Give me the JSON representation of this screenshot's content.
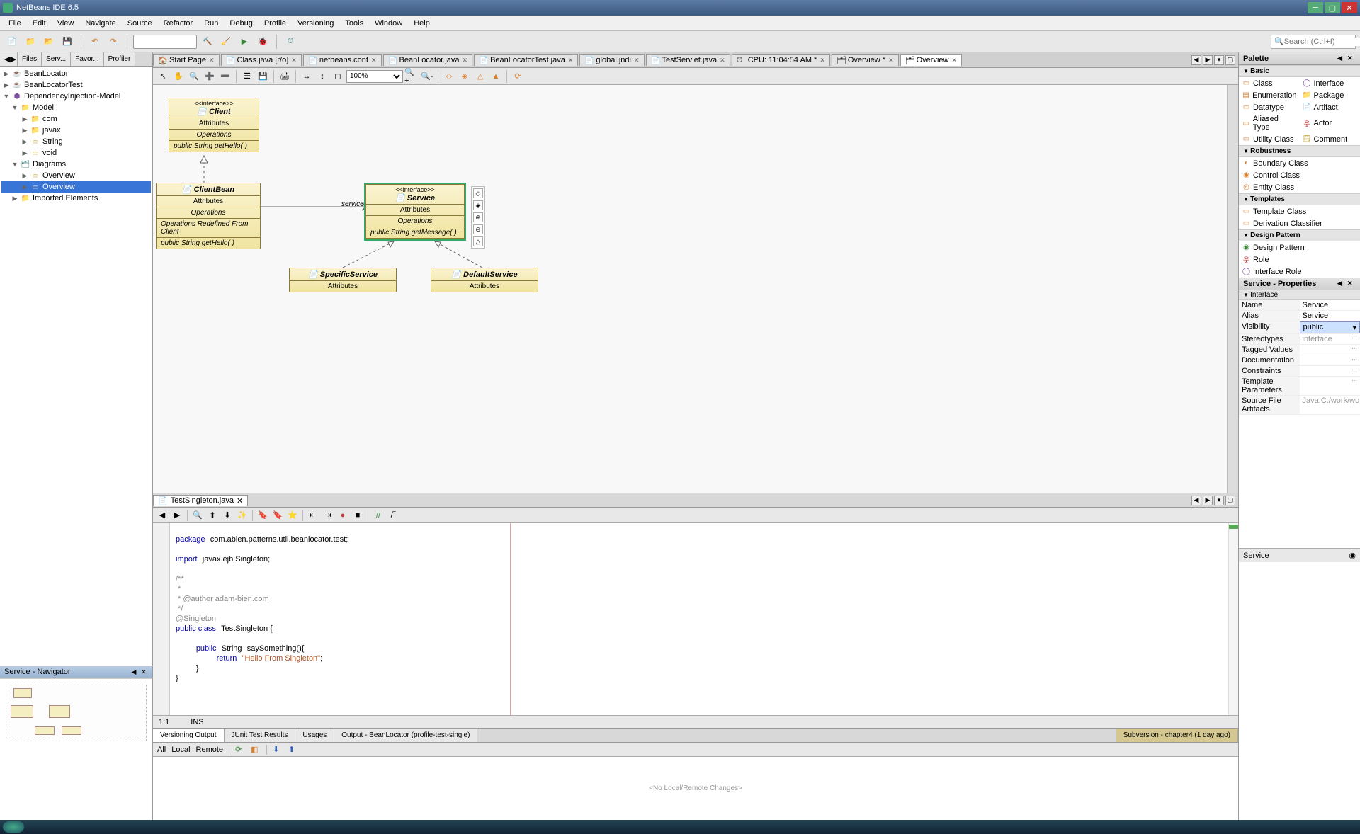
{
  "title": "NetBeans IDE 6.5",
  "menu": [
    "File",
    "Edit",
    "View",
    "Navigate",
    "Source",
    "Refactor",
    "Run",
    "Debug",
    "Profile",
    "Versioning",
    "Tools",
    "Window",
    "Help"
  ],
  "search_placeholder": "Search (Ctrl+I)",
  "left_tabs": [
    "Files",
    "Serv...",
    "Favor...",
    "Profiler"
  ],
  "tree": {
    "n0": "BeanLocator",
    "n1": "BeanLocatorTest",
    "n2": "DependencyInjection-Model",
    "n3": "Model",
    "n4": "com",
    "n5": "javax",
    "n6": "String",
    "n7": "void",
    "n8": "Diagrams",
    "n9": "Overview",
    "n10": "Overview",
    "n11": "Imported Elements"
  },
  "navigator_title": "Service - Navigator",
  "editor_tabs": [
    {
      "label": "Start Page",
      "icon": "🏠"
    },
    {
      "label": "Class.java [r/o]",
      "icon": "📄"
    },
    {
      "label": "netbeans.conf",
      "icon": "📄"
    },
    {
      "label": "BeanLocator.java",
      "icon": "📄"
    },
    {
      "label": "BeanLocatorTest.java",
      "icon": "📄"
    },
    {
      "label": "global.jndi",
      "icon": "📄"
    },
    {
      "label": "TestServlet.java",
      "icon": "📄"
    },
    {
      "label": "CPU: 11:04:54 AM *",
      "icon": "⏱"
    },
    {
      "label": "Overview *",
      "icon": "🗂"
    },
    {
      "label": "Overview",
      "icon": "🗂"
    }
  ],
  "zoom": "100%",
  "uml": {
    "client": {
      "stereo": "<<interface>>",
      "name": "Client",
      "attrs": "Attributes",
      "ops_hdr": "Operations",
      "op1": "public String  getHello( )"
    },
    "clientbean": {
      "name": "ClientBean",
      "attrs": "Attributes",
      "ops_hdr": "Operations",
      "redef": "Operations Redefined From Client",
      "op1": "public String  getHello( )"
    },
    "service": {
      "stereo": "<<interface>>",
      "name": "Service",
      "attrs": "Attributes",
      "ops_hdr": "Operations",
      "op1": "public String  getMessage( )",
      "assoc": "service"
    },
    "specific": {
      "name": "SpecificService",
      "attrs": "Attributes"
    },
    "default": {
      "name": "DefaultService",
      "attrs": "Attributes"
    }
  },
  "code_tab": "TestSingleton.java",
  "code": {
    "pkg": "package",
    "pkg_path": "com.abien.patterns.util.beanlocator.test;",
    "imp": "import",
    "imp_path": "javax.ejb.Singleton;",
    "c1": "/**",
    "c2": " *",
    "c3": " * @author adam-bien.com",
    "c4": " */",
    "ann": "@Singleton",
    "cls": "public class",
    "cls_name": "TestSingleton {",
    "meth": "public",
    "meth_type": "String",
    "meth_name": "saySomething(){",
    "ret": "return",
    "ret_val": "\"Hello From Singleton\"",
    "semi": ";",
    "brace1": "}",
    "brace2": "}"
  },
  "code_status": {
    "pos": "1:1",
    "mode": "INS"
  },
  "output_tabs": [
    "Versioning Output",
    "JUnit Test Results",
    "Usages",
    "Output - BeanLocator (profile-test-single)"
  ],
  "output_tab_ext": "Subversion - chapter4 (1 day ago)",
  "output_filter": {
    "all": "All",
    "local": "Local",
    "remote": "Remote"
  },
  "output_msg": "<No Local/Remote Changes>",
  "palette": {
    "title": "Palette",
    "cats": {
      "basic": "Basic",
      "robust": "Robustness",
      "templates": "Templates",
      "design": "Design Pattern"
    },
    "basic_items": [
      "Class",
      "Interface",
      "Enumeration",
      "Package",
      "Datatype",
      "Artifact",
      "Aliased Type",
      "Actor",
      "Utility Class",
      "Comment"
    ],
    "robust_items": [
      "Boundary Class",
      "Control Class",
      "Entity Class"
    ],
    "template_items": [
      "Template Class",
      "Derivation Classifier"
    ],
    "design_items": [
      "Design Pattern",
      "Role",
      "Interface Role"
    ]
  },
  "props": {
    "title": "Service - Properties",
    "cat": "Interface",
    "rows": [
      {
        "k": "Name",
        "v": "Service"
      },
      {
        "k": "Alias",
        "v": "Service"
      },
      {
        "k": "Visibility",
        "v": "public"
      },
      {
        "k": "Stereotypes",
        "v": "interface"
      },
      {
        "k": "Tagged Values",
        "v": ""
      },
      {
        "k": "Documentation",
        "v": ""
      },
      {
        "k": "Constraints",
        "v": ""
      },
      {
        "k": "Template Parameters",
        "v": ""
      },
      {
        "k": "Source File Artifacts",
        "v": "Java:C:/work/works"
      }
    ]
  },
  "svc_footer": "Service"
}
